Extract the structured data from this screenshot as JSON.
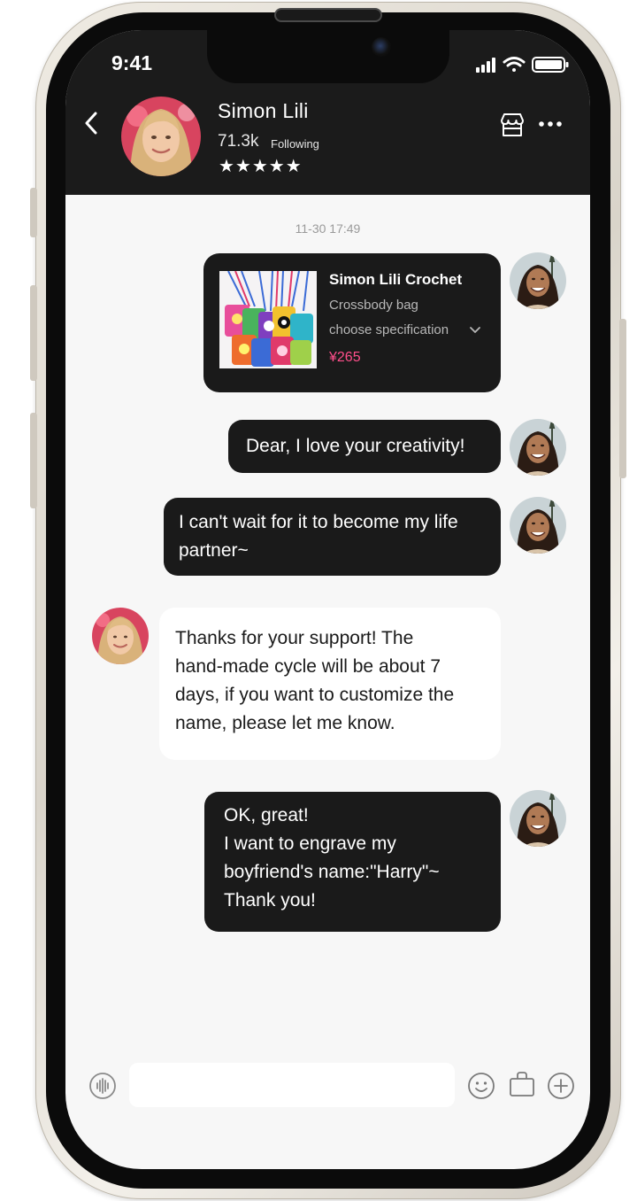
{
  "status_bar": {
    "time": "9:41"
  },
  "header": {
    "shop_name": "Simon Lili",
    "followers_count": "71.3k",
    "followers_label": "Following",
    "rating_stars": "★★★★★"
  },
  "chat": {
    "timestamp": "11-30 17:49",
    "product_card": {
      "title": "Simon Lili Crochet",
      "subtitle": "Crossbody bag",
      "spec_label": "choose specification",
      "price": "¥265"
    },
    "messages": [
      {
        "from": "me",
        "text": "Dear, I love your creativity!"
      },
      {
        "from": "me",
        "text": "I can't wait for it to become my life\npartner~"
      },
      {
        "from": "shop",
        "text": "Thanks for your support! The\nhand-made cycle will be about 7\ndays, if you want to customize the\nname, please let me know."
      },
      {
        "from": "me",
        "text": "OK, great!\nI want to engrave my\nboyfriend's name:\"Harry\"~\nThank you!"
      }
    ]
  },
  "input_bar": {
    "placeholder": ""
  },
  "icons": {
    "back": "chevron-left-icon",
    "store": "store-icon",
    "more": "more-icon",
    "voice": "voice-icon",
    "emoji": "emoji-icon",
    "bag": "shopping-bag-icon",
    "plus": "plus-icon"
  },
  "colors": {
    "header_bg": "#1b1b1b",
    "bubble_dark": "#1a1a1a",
    "bubble_light": "#ffffff",
    "chat_bg": "#f7f7f7",
    "price": "#ff4f8b"
  }
}
